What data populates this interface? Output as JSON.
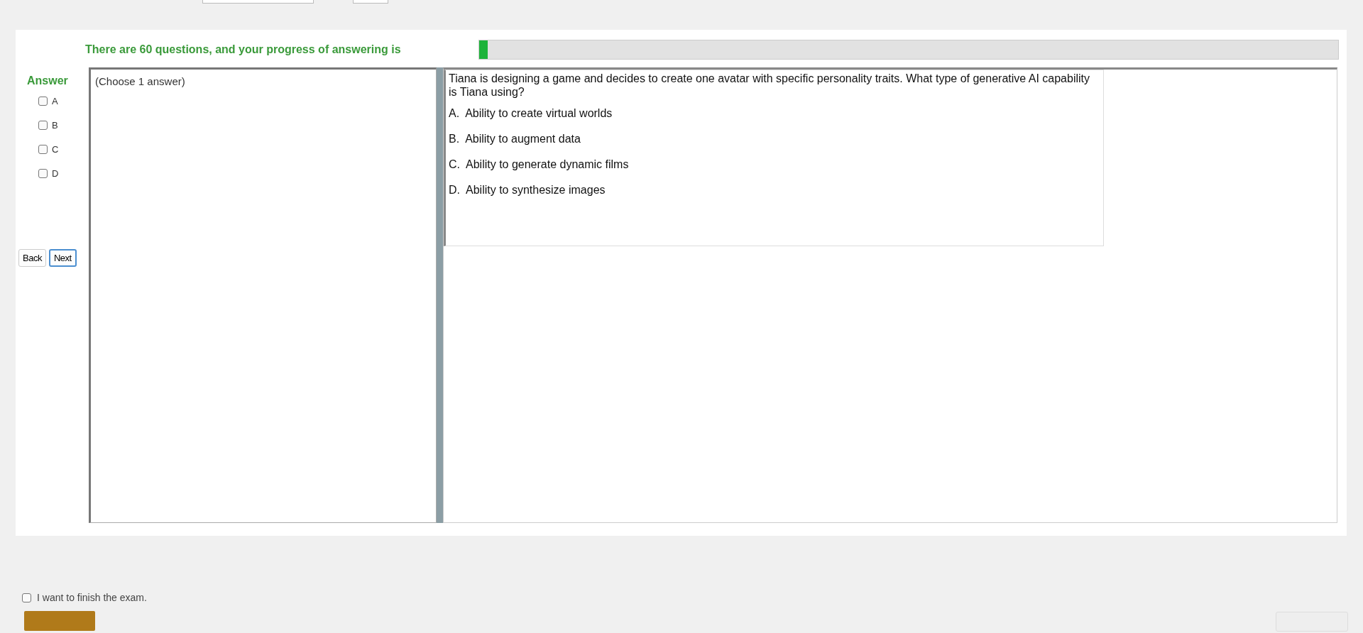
{
  "progress": {
    "text": "There are 60 questions, and your progress of answering is",
    "level": 0.01
  },
  "answer": {
    "label": "Answer",
    "note": "(Choose 1 answer)",
    "options": [
      {
        "label": "A",
        "checked": false
      },
      {
        "label": "B",
        "checked": false
      },
      {
        "label": "C",
        "checked": false
      },
      {
        "label": "D",
        "checked": false
      }
    ]
  },
  "nav": {
    "back": "Back",
    "next": "Next"
  },
  "question": {
    "text": "Tiana is designing a game and decides to create one avatar with specific personality traits. What type of generative AI capability is Tiana using?",
    "choices": [
      {
        "letter": "A.",
        "text": "Ability to create virtual worlds"
      },
      {
        "letter": "B.",
        "text": "Ability to augment data"
      },
      {
        "letter": "C.",
        "text": "Ability to generate dynamic films"
      },
      {
        "letter": "D.",
        "text": "Ability to synthesize images"
      }
    ]
  },
  "finish": {
    "label": "I want to finish the exam.",
    "checked": false
  }
}
